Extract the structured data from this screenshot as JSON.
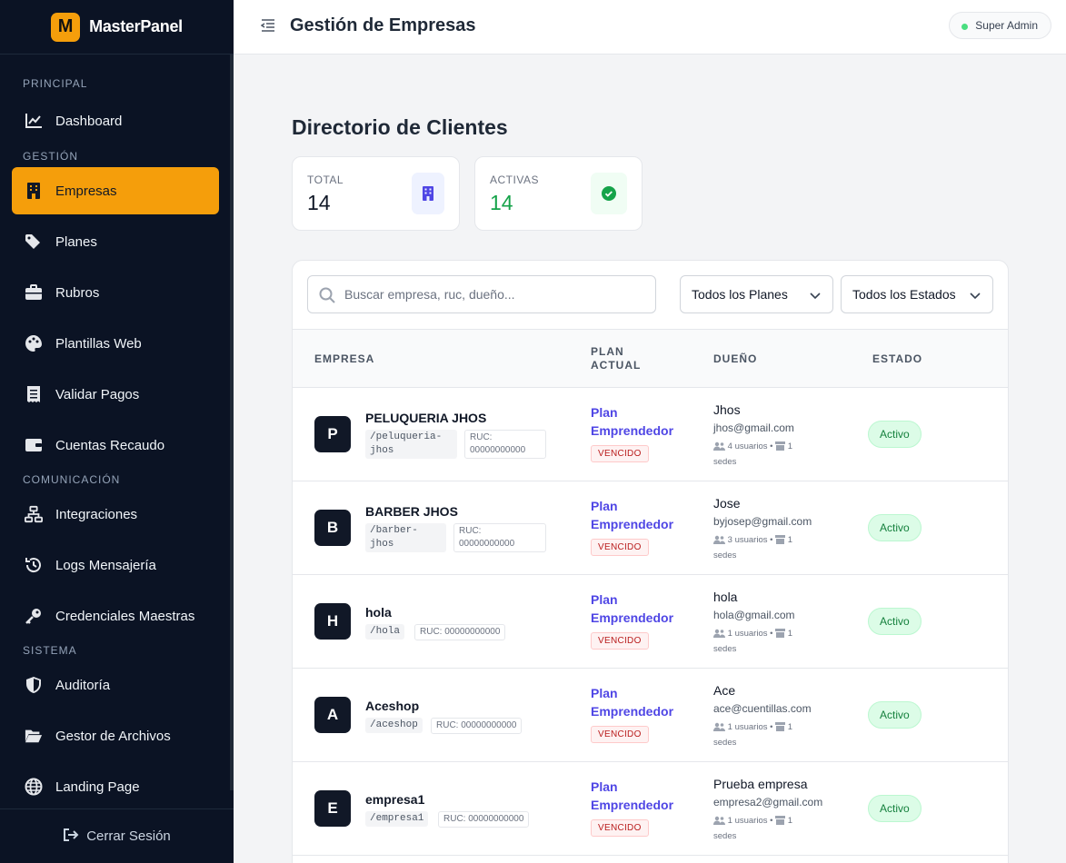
{
  "brand": {
    "logo_letter": "M",
    "name": "MasterPanel"
  },
  "sidebar": {
    "sections": [
      "PRINCIPAL",
      "GESTIÓN",
      "COMUNICACIÓN",
      "SISTEMA"
    ],
    "items": [
      {
        "label": "Dashboard",
        "icon": "chart-line-icon"
      },
      {
        "label": "Empresas",
        "icon": "building-icon",
        "active": true
      },
      {
        "label": "Planes",
        "icon": "tags-icon"
      },
      {
        "label": "Rubros",
        "icon": "briefcase-icon"
      },
      {
        "label": "Plantillas Web",
        "icon": "palette-icon"
      },
      {
        "label": "Validar Pagos",
        "icon": "receipt-icon"
      },
      {
        "label": "Cuentas Recaudo",
        "icon": "wallet-icon"
      },
      {
        "label": "Integraciones",
        "icon": "network-icon"
      },
      {
        "label": "Logs Mensajería",
        "icon": "history-icon"
      },
      {
        "label": "Credenciales Maestras",
        "icon": "key-icon"
      },
      {
        "label": "Auditoría",
        "icon": "shield-icon"
      },
      {
        "label": "Gestor de Archivos",
        "icon": "folder-open-icon"
      },
      {
        "label": "Landing Page",
        "icon": "globe-icon"
      }
    ],
    "logout_label": "Cerrar Sesión"
  },
  "header": {
    "title": "Gestión de Empresas",
    "role_badge": "Super Admin"
  },
  "main": {
    "title": "Directorio de Clientes",
    "stats": [
      {
        "label": "TOTAL",
        "value": "14",
        "icon": "building-icon",
        "color": "#111827"
      },
      {
        "label": "ACTIVAS",
        "value": "14",
        "icon": "check-circle-icon",
        "color": "#16a34a"
      }
    ],
    "search_placeholder": "Buscar empresa, ruc, dueño...",
    "filter_plan": "Todos los Planes",
    "filter_status": "Todos los Estados",
    "columns": {
      "empresa": "EMPRESA",
      "plan_line1": "PLAN",
      "plan_line2": "ACTUAL",
      "dueno": "DUEÑO",
      "estado": "ESTADO"
    },
    "rows": [
      {
        "initial": "P",
        "name": "PELUQUERIA JHOS",
        "slug1": "/peluqueria-",
        "slug2": "jhos",
        "ruc1": "RUC:",
        "ruc2": "00000000000",
        "plan1": "Plan",
        "plan2": "Emprendedor",
        "plan_status": "VENCIDO",
        "owner": "Jhos",
        "email": "jhos@gmail.com",
        "users": "4 usuarios",
        "sedes_count": "1",
        "sedes_label": "sedes",
        "status": "Activo"
      },
      {
        "initial": "B",
        "name": "BARBER JHOS",
        "slug1": "/barber-",
        "slug2": "jhos",
        "ruc1": "RUC:",
        "ruc2": "00000000000",
        "plan1": "Plan",
        "plan2": "Emprendedor",
        "plan_status": "VENCIDO",
        "owner": "Jose",
        "email": "byjosep@gmail.com",
        "users": "3 usuarios",
        "sedes_count": "1",
        "sedes_label": "sedes",
        "status": "Activo"
      },
      {
        "initial": "H",
        "name": "hola",
        "slug1": "/hola",
        "ruc": "RUC: 00000000000",
        "plan1": "Plan",
        "plan2": "Emprendedor",
        "plan_status": "VENCIDO",
        "owner": "hola",
        "email": "hola@gmail.com",
        "users": "1 usuarios",
        "sedes_count": "1",
        "sedes_label": "sedes",
        "status": "Activo"
      },
      {
        "initial": "A",
        "name": "Aceshop",
        "slug1": "/aceshop",
        "ruc": "RUC: 00000000000",
        "plan1": "Plan",
        "plan2": "Emprendedor",
        "plan_status": "VENCIDO",
        "owner": "Ace",
        "email": "ace@cuentillas.com",
        "users": "1 usuarios",
        "sedes_count": "1",
        "sedes_label": "sedes",
        "status": "Activo"
      },
      {
        "initial": "E",
        "name": "empresa1",
        "slug1": "/empresa1",
        "ruc": "RUC: 00000000000",
        "plan1": "Plan",
        "plan2": "Emprendedor",
        "plan_status": "VENCIDO",
        "owner": "Prueba empresa",
        "email": "empresa2@gmail.com",
        "users": "1 usuarios",
        "sedes_count": "1",
        "sedes_label": "sedes",
        "status": "Activo"
      }
    ]
  }
}
